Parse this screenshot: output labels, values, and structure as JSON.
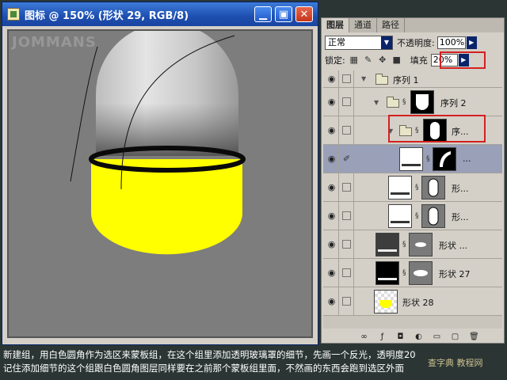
{
  "document": {
    "title": "图标 @ 150% (形状 29, RGB/8)",
    "watermark": "JOMMANS",
    "buttons": {
      "minimize": "▁",
      "restore": "▣",
      "close": "✕"
    }
  },
  "layers_panel": {
    "tabs": [
      "图层",
      "通道",
      "路径"
    ],
    "blend_mode": "正常",
    "opacity_label": "不透明度:",
    "opacity_value": "100%",
    "lock_label": "锁定:",
    "fill_label": "填充",
    "fill_value": "20%",
    "layers": [
      {
        "name": "序列 1",
        "type": "group"
      },
      {
        "name": "序列 2",
        "type": "group"
      },
      {
        "name": "序...",
        "type": "group",
        "highlighted": true
      },
      {
        "name": "...",
        "type": "shape",
        "selected": true
      },
      {
        "name": "形...",
        "type": "shape"
      },
      {
        "name": "形...",
        "type": "shape"
      },
      {
        "name": "形状 ...",
        "type": "shape"
      },
      {
        "name": "形状 27",
        "type": "shape"
      },
      {
        "name": "形状 28",
        "type": "shape"
      }
    ]
  },
  "caption": {
    "line1": "新建组，用白色圆角作为选区来蒙板组，在这个组里添加透明玻璃罩的细节，先画一个反光，透明度20",
    "line2": "记住添加细节的这个组跟白色圆角图层同样要在之前那个蒙板组里面，不然画的东西会跑到选区外面"
  },
  "site_mark": "查字典 教程网",
  "colors": {
    "accent_red": "#d42020",
    "capsule_yellow": "#ffff00",
    "title_blue": "#1d4fb0"
  }
}
